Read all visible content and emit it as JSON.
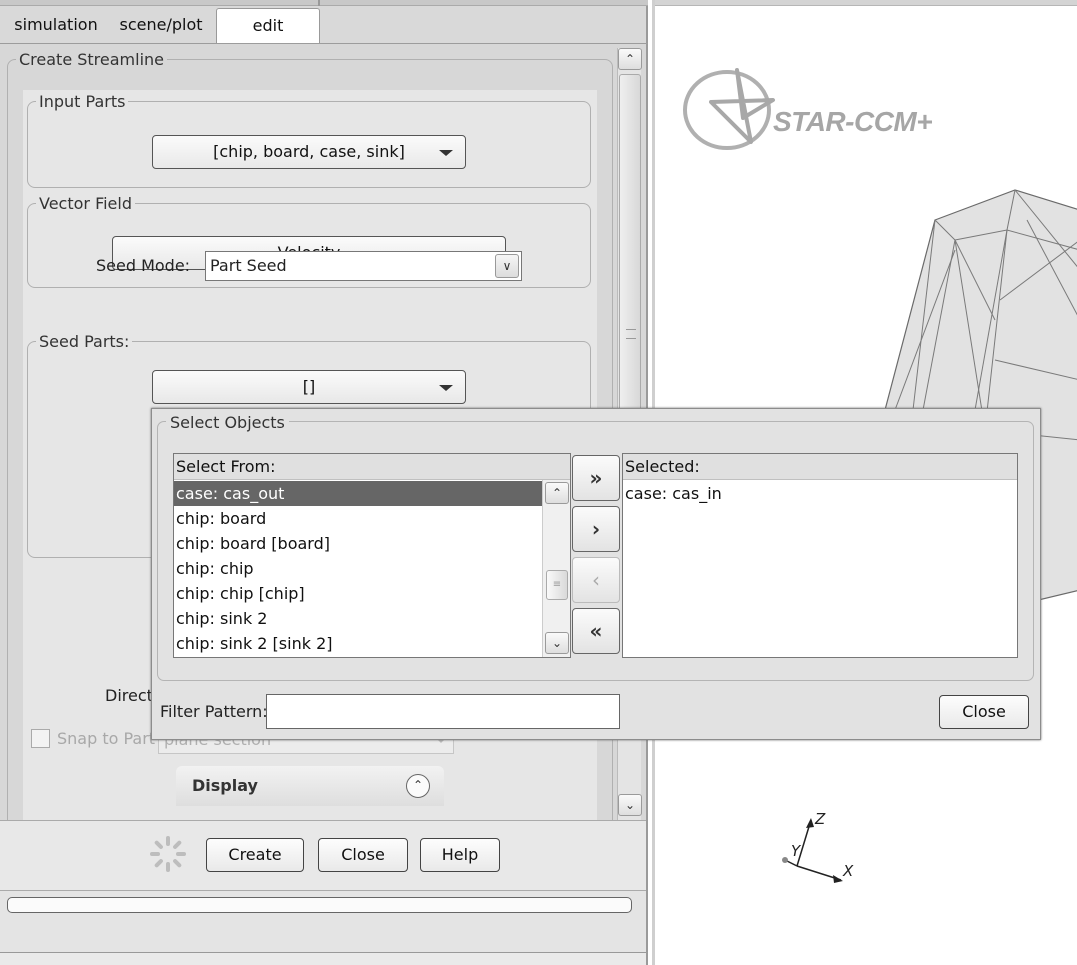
{
  "tabs": [
    "simulation",
    "scene/plot",
    "edit"
  ],
  "panel": {
    "title": "Create Streamline",
    "input_parts_label": "Input Parts",
    "input_parts_value": "[chip, board, case, sink]",
    "vector_field_label": "Vector Field",
    "vector_field_value": "Velocity",
    "seed_mode_label": "Seed Mode:",
    "seed_mode_value": "Part Seed",
    "seed_parts_label": "Seed Parts:",
    "seed_parts_value": "[]",
    "direction_label": "Direct",
    "snap_label": "Snap to Part",
    "plane_value": "plane section",
    "display_title": "Display"
  },
  "buttons": {
    "create": "Create",
    "close": "Close",
    "help": "Help"
  },
  "viewport": {
    "logo_text": "STAR-CCM+",
    "axes": {
      "z": "Z",
      "y": "Y",
      "x": "X"
    }
  },
  "select_objects": {
    "title": "Select Objects",
    "select_from_header": "Select From:",
    "select_from_items": [
      "case: cas_out",
      "chip: board",
      "chip: board [board]",
      "chip: chip",
      "chip: chip [chip]",
      "chip: sink 2",
      "chip: sink 2 [sink 2]"
    ],
    "selected_header": "Selected:",
    "selected_items": [
      "case: cas_in"
    ],
    "filter_label": "Filter Pattern:",
    "filter_value": "",
    "close_label": "Close",
    "move_buttons": {
      "add_all": "»",
      "add": "›",
      "remove": "‹",
      "remove_all": "«"
    }
  },
  "icons": {
    "spinner": "spinner-icon",
    "collapse": "collapse-up-icon",
    "logo": "star-logo-icon"
  }
}
